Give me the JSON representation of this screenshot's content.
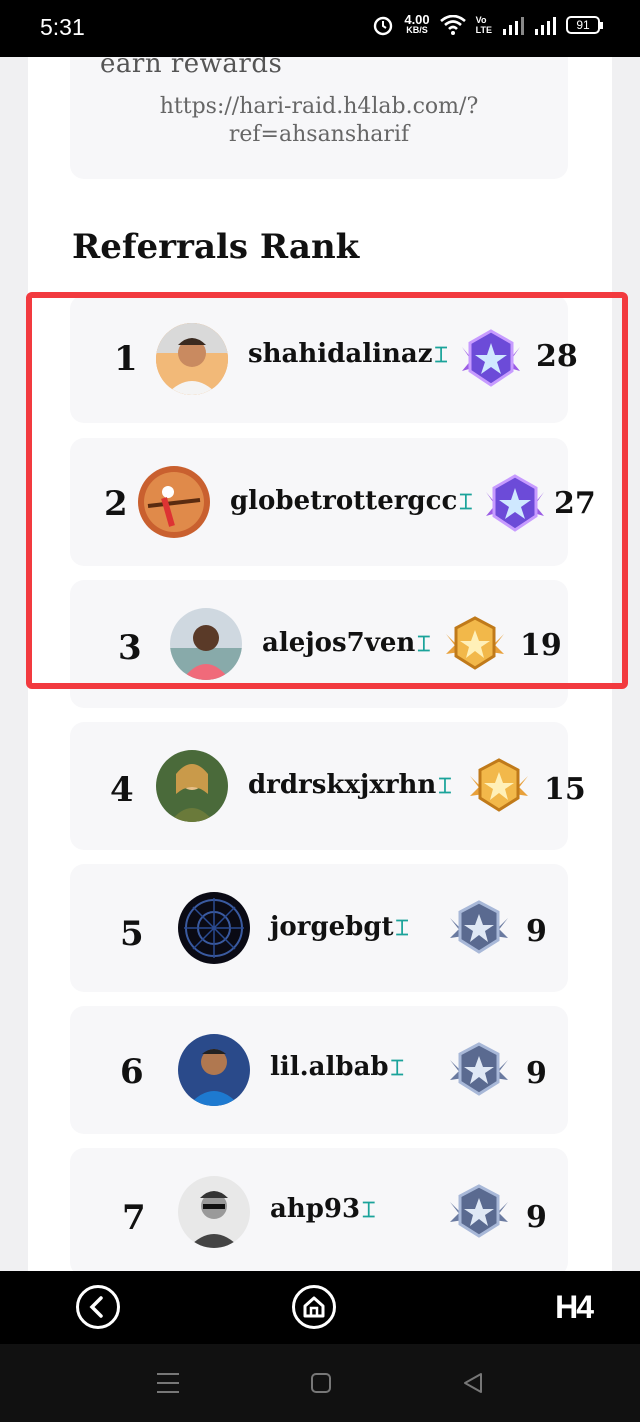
{
  "status_bar": {
    "time": "5:31",
    "speed_value": "4.00",
    "speed_unit": "KB/S",
    "lte_top": "Vo",
    "lte_bottom": "LTE",
    "battery": "91"
  },
  "referral": {
    "title": "earn rewards",
    "link_line1": "https://hari-raid.h4lab.com/?",
    "link_line2": "ref=ahsansharif"
  },
  "section_title": "Referrals Rank",
  "ranks": [
    {
      "rank": "1",
      "name": "shahidalinaz",
      "score": "28",
      "badge": "purple-star-badge"
    },
    {
      "rank": "2",
      "name": "globetrottergcc",
      "score": "27",
      "badge": "purple-star-badge"
    },
    {
      "rank": "3",
      "name": "alejos7ven",
      "score": "19",
      "badge": "gold-star-badge"
    },
    {
      "rank": "4",
      "name": "drdrskxjxrhn",
      "score": "15",
      "badge": "gold-star-badge"
    },
    {
      "rank": "5",
      "name": "jorgebgt",
      "score": "9",
      "badge": "silver-star-badge"
    },
    {
      "rank": "6",
      "name": "lil.albab",
      "score": "9",
      "badge": "silver-star-badge"
    },
    {
      "rank": "7",
      "name": "ahp93",
      "score": "9",
      "badge": "silver-star-badge"
    }
  ],
  "app_nav": {
    "logo": "H4"
  },
  "colors": {
    "highlight": "#f23a3f",
    "verified_icon": "#1aa39a",
    "card_bg": "#f7f7f9"
  }
}
